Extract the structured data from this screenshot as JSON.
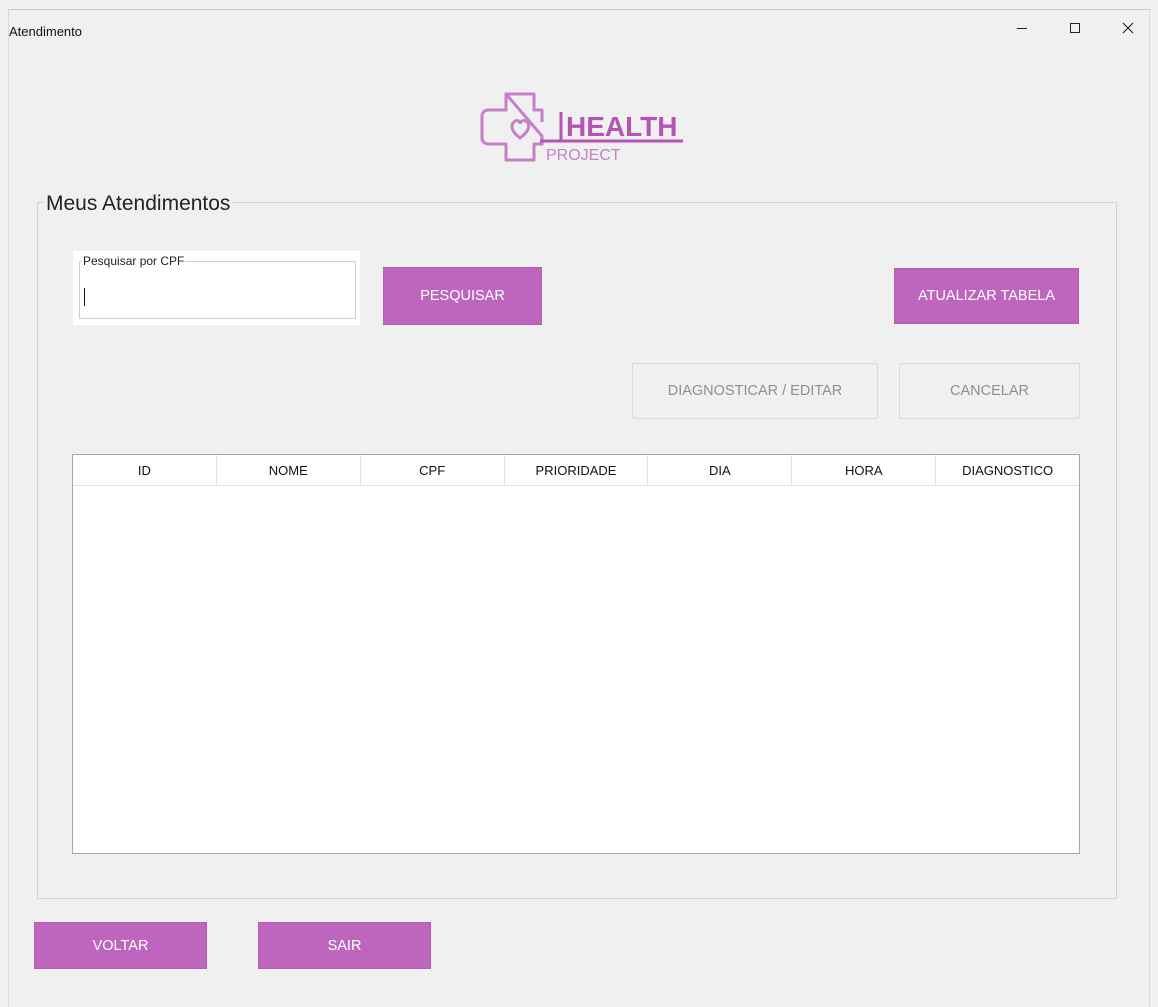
{
  "window": {
    "title": "Atendimento",
    "controls": [
      "minimize-icon",
      "maximize-icon",
      "close-icon"
    ]
  },
  "logo": {
    "word1": "HEALTH",
    "word2": "PROJECT",
    "color": "#be66be"
  },
  "section": {
    "title": "Meus Atendimentos"
  },
  "search": {
    "label": "Pesquisar por CPF",
    "value": "",
    "search_button": "PESQUISAR"
  },
  "actions": {
    "refresh_button": "ATUALIZAR TABELA",
    "diagnose_button": "DIAGNOSTICAR / EDITAR",
    "cancel_button": "CANCELAR"
  },
  "table": {
    "columns": [
      "ID",
      "NOME",
      "CPF",
      "PRIORIDADE",
      "DIA",
      "HORA",
      "DIAGNOSTICO"
    ],
    "rows": []
  },
  "footer": {
    "back_button": "VOLTAR",
    "exit_button": "SAIR"
  },
  "colors": {
    "accent": "#be66be",
    "background": "#f0f0f0",
    "disabled_text": "#8f8f8f"
  }
}
